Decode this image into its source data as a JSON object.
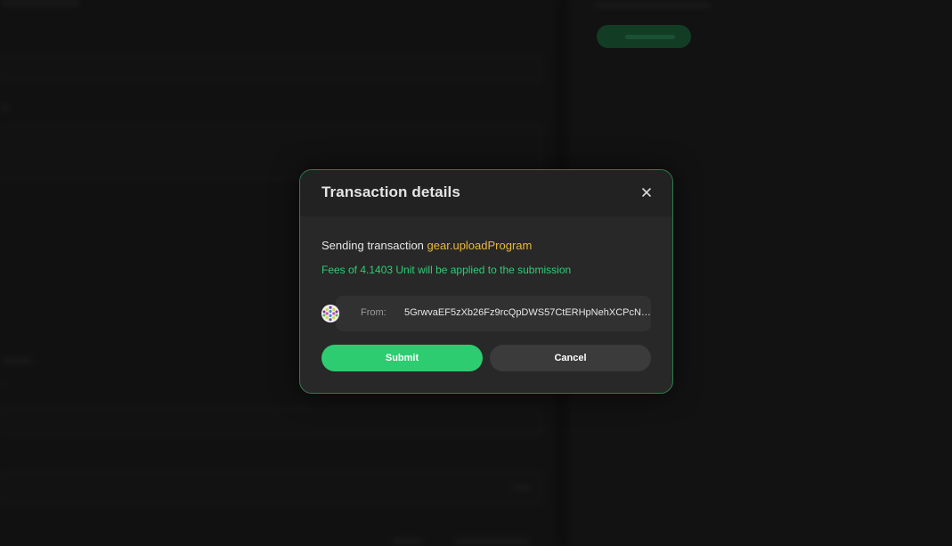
{
  "modal": {
    "title": "Transaction details",
    "close_icon": "close-icon",
    "sending_prefix": "Sending transaction",
    "method": "gear.uploadProgram",
    "fees_text": "Fees of 4.1403 Unit will be applied to the submission",
    "from_label": "From:",
    "from_address": "5GrwvaEF5zXb26Fz9rcQpDWS57CtERHpNehXCPcNo...",
    "avatar_icon": "identicon-avatar",
    "submit_label": "Submit",
    "cancel_label": "Cancel"
  },
  "colors": {
    "accent_green": "#2ecc71",
    "method_yellow": "#e8b83d",
    "fees_green": "#2fcc74",
    "modal_border": "#2f7d4e"
  }
}
